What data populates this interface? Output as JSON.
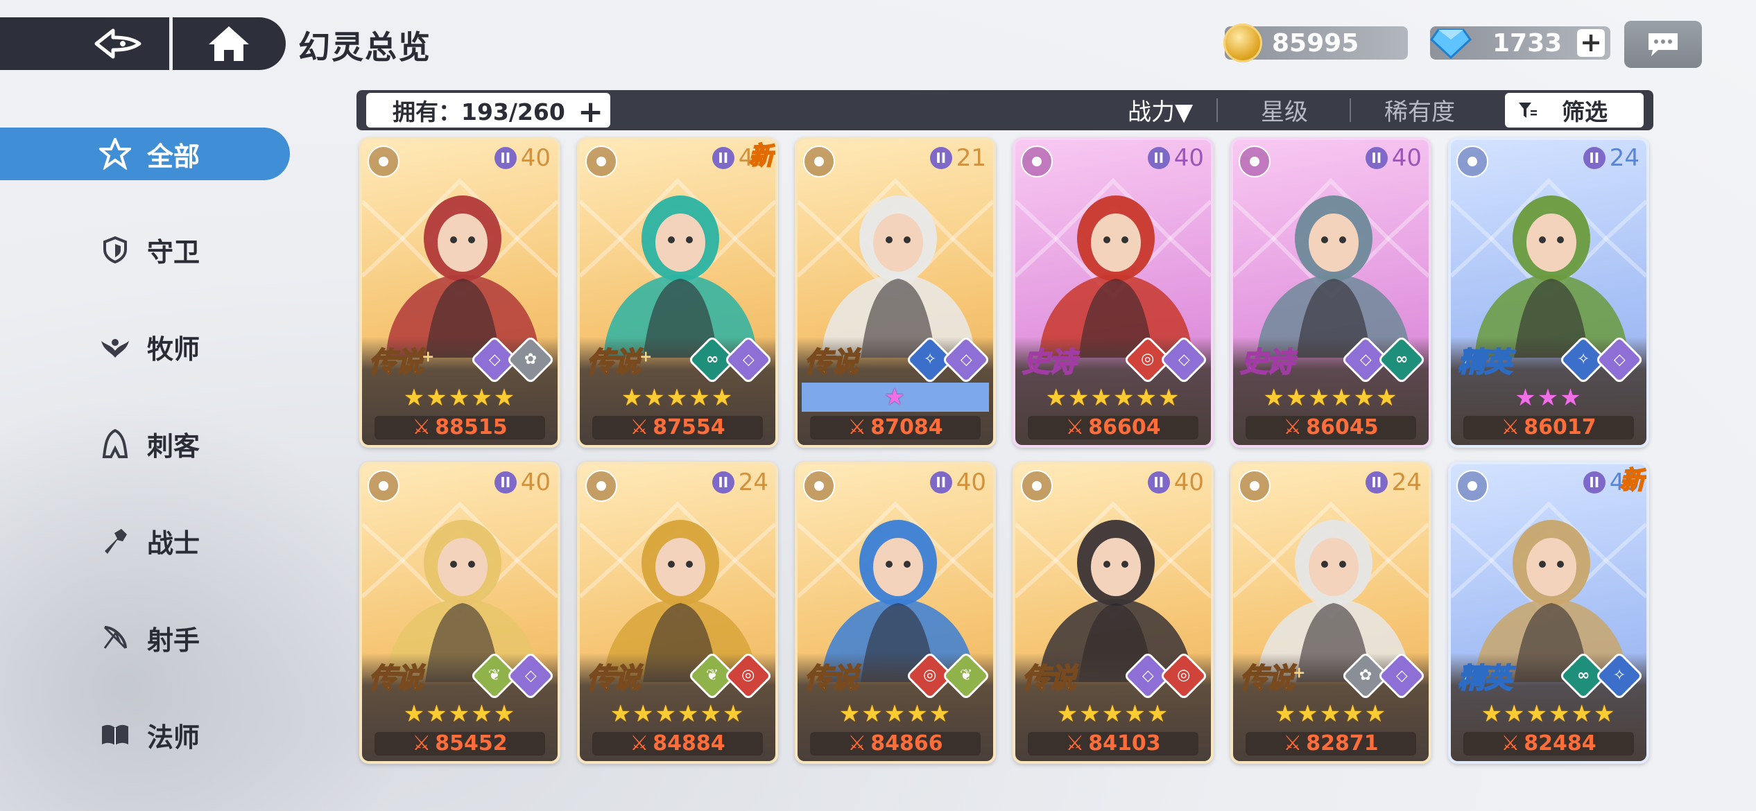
{
  "header": {
    "title": "幻灵总览",
    "back_icon": "back-arrow-icon",
    "home_icon": "home-icon"
  },
  "resources": {
    "coins": "85995",
    "gems": "1733",
    "gem_plus": "+"
  },
  "filter": {
    "owned_label": "拥有：193/260",
    "owned_plus": "+",
    "sort_power": "战力▼",
    "sort_star": "星级",
    "sort_rarity": "稀有度",
    "filter_label": "筛选"
  },
  "sidebar": {
    "items": [
      {
        "label": "全部",
        "icon": "all-star-icon",
        "active": true
      },
      {
        "label": "守卫",
        "icon": "shield-icon"
      },
      {
        "label": "牧师",
        "icon": "priest-icon"
      },
      {
        "label": "刺客",
        "icon": "assassin-icon"
      },
      {
        "label": "战士",
        "icon": "warrior-icon"
      },
      {
        "label": "射手",
        "icon": "archer-icon"
      },
      {
        "label": "法师",
        "icon": "book-icon"
      }
    ]
  },
  "cards": [
    {
      "rarity": "传说",
      "plus": "+",
      "level": "40",
      "stars": "★★★★★",
      "power": "88515",
      "new": "",
      "tier": "legend",
      "accent": "#b23a3a"
    },
    {
      "rarity": "传说",
      "plus": "+",
      "level": "40",
      "stars": "★★★★★",
      "power": "87554",
      "new": "新",
      "tier": "legend",
      "accent": "#2bb3a3"
    },
    {
      "rarity": "传说",
      "plus": "",
      "level": "21",
      "stars": "★",
      "power": "87084",
      "new": "",
      "tier": "legend",
      "accent": "#e9e9e9"
    },
    {
      "rarity": "史诗",
      "plus": "",
      "level": "40",
      "stars": "★★★★★★",
      "power": "86604",
      "new": "",
      "tier": "epic",
      "accent": "#c8382b"
    },
    {
      "rarity": "史诗",
      "plus": "",
      "level": "40",
      "stars": "★★★★★★",
      "power": "86045",
      "new": "",
      "tier": "epic",
      "accent": "#6e8a99"
    },
    {
      "rarity": "精英",
      "plus": "",
      "level": "24",
      "stars": "★★★",
      "power": "86017",
      "new": "",
      "tier": "elite",
      "accent": "#6a9b3d"
    },
    {
      "rarity": "传说",
      "plus": "",
      "level": "40",
      "stars": "★★★★★",
      "power": "85452",
      "new": "",
      "tier": "legend",
      "accent": "#e8c56a"
    },
    {
      "rarity": "传说",
      "plus": "",
      "level": "24",
      "stars": "★★★★★★",
      "power": "84884",
      "new": "",
      "tier": "legend",
      "accent": "#d8a43a"
    },
    {
      "rarity": "传说",
      "plus": "",
      "level": "40",
      "stars": "★★★★★",
      "power": "84866",
      "new": "",
      "tier": "legend",
      "accent": "#3b7fd6"
    },
    {
      "rarity": "传说",
      "plus": "",
      "level": "40",
      "stars": "★★★★★",
      "power": "84103",
      "new": "",
      "tier": "legend",
      "accent": "#3b3436"
    },
    {
      "rarity": "传说",
      "plus": "+",
      "level": "24",
      "stars": "★★★★★",
      "power": "82871",
      "new": "",
      "tier": "legend",
      "accent": "#e6e6e6"
    },
    {
      "rarity": "精英",
      "plus": "",
      "level": "40",
      "stars": "★★★★★★",
      "power": "82484",
      "new": "新",
      "tier": "elite",
      "accent": "#c9a66b"
    }
  ]
}
